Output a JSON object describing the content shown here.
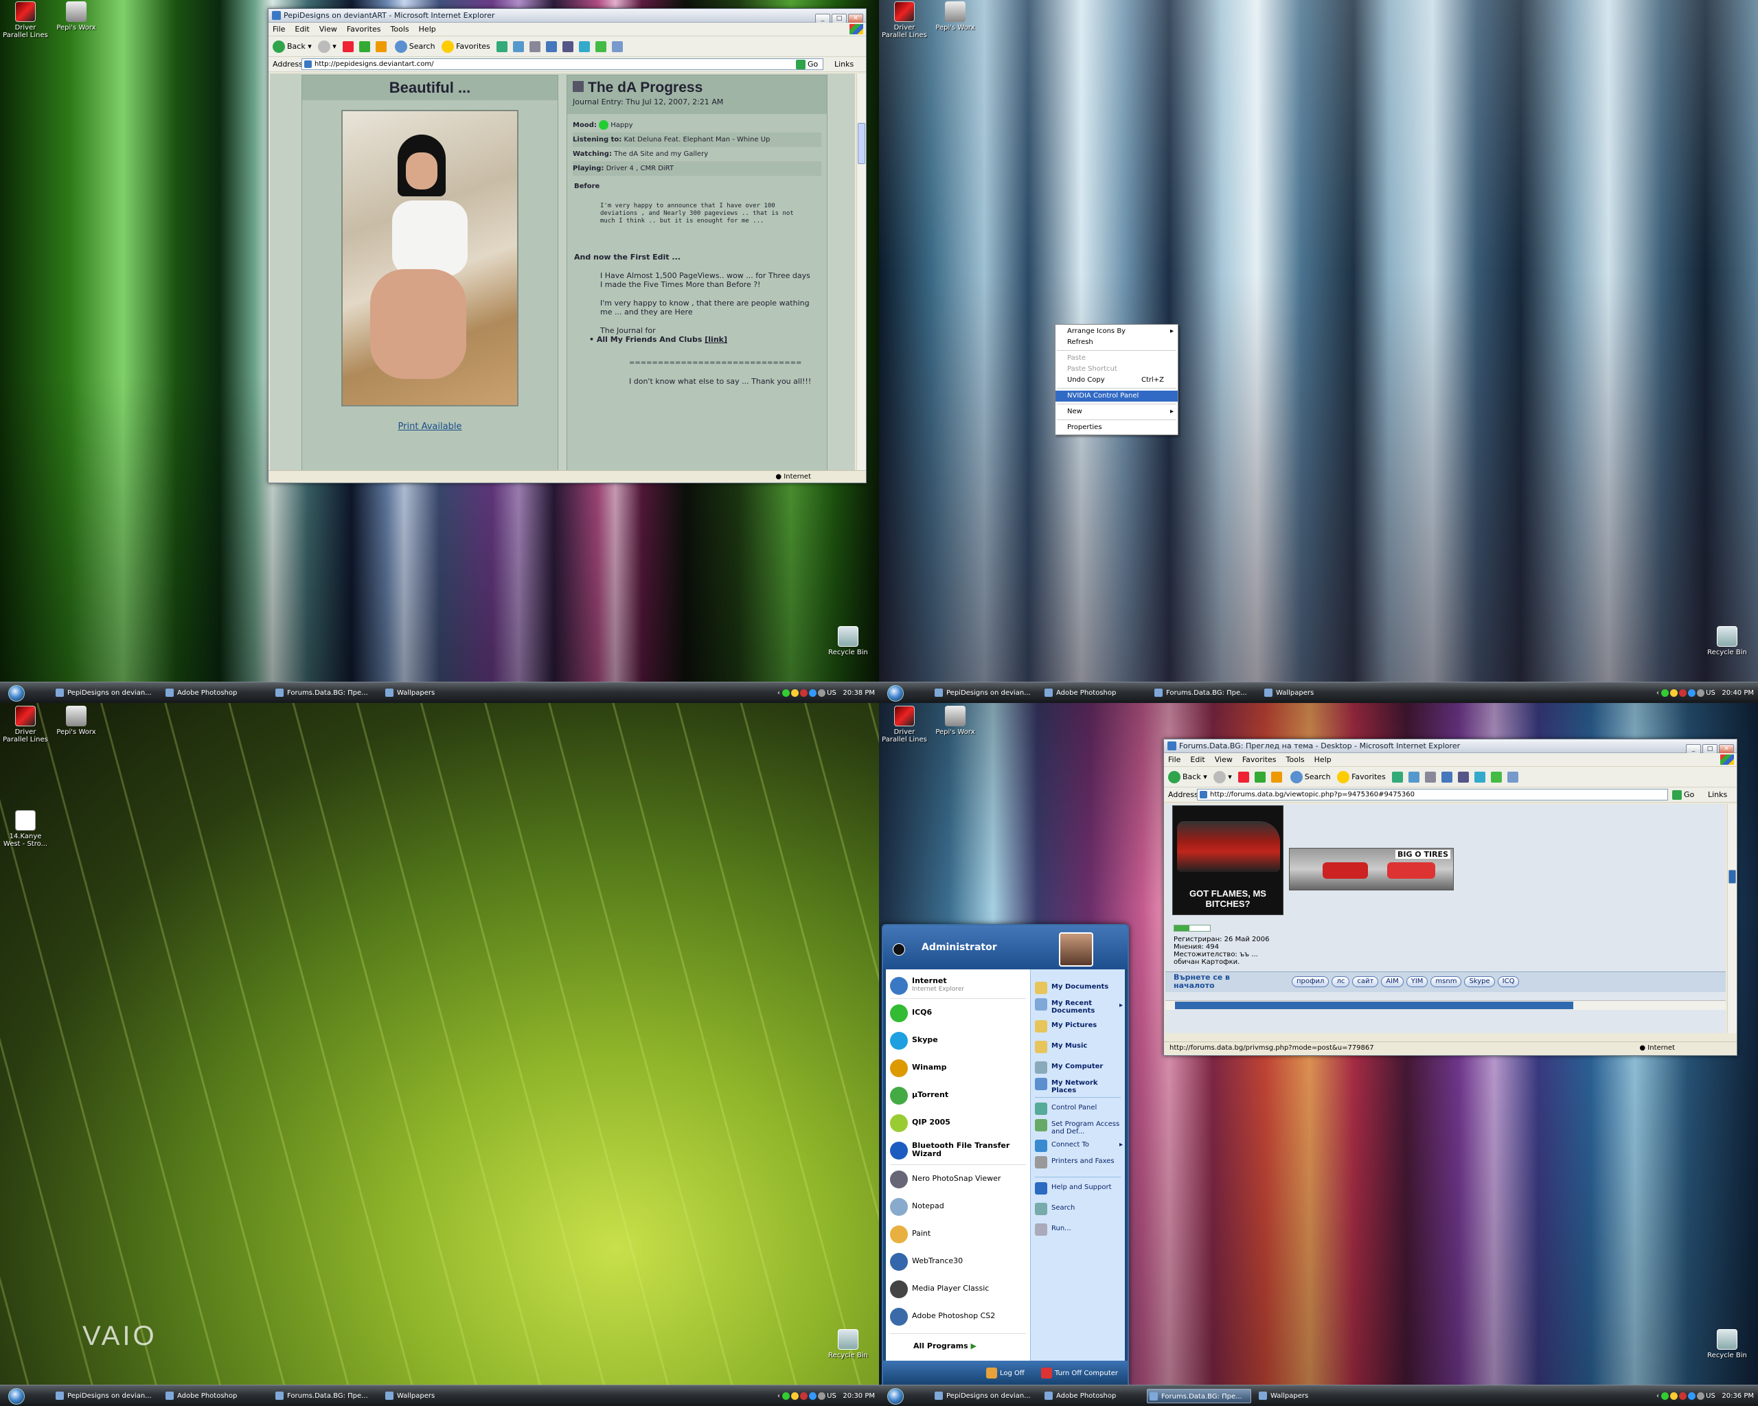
{
  "desktop_icons": {
    "driver": "Driver Parallel Lines",
    "pepi": "Pepi's Worx",
    "bin": "Recycle Bin",
    "kanye": "14.Kanye West - Stro..."
  },
  "taskbar": {
    "items": [
      "PepiDesigns on devian...",
      "Adobe Photoshop",
      "Forums.Data.BG: Пре...",
      "Wallpapers"
    ],
    "lang": "US",
    "time_q1": "20:38 PM",
    "time_q2": "20:40 PM",
    "time_q3": "20:30 PM",
    "time_q4": "20:36 PM"
  },
  "ie_common": {
    "menu": [
      "File",
      "Edit",
      "View",
      "Favorites",
      "Tools",
      "Help"
    ],
    "back": "Back",
    "search": "Search",
    "favorites": "Favorites",
    "address_label": "Address",
    "go": "Go",
    "links": "Links",
    "zone": "Internet"
  },
  "da_window": {
    "title": "PepiDesigns on deviantART - Microsoft Internet Explorer",
    "url": "http://pepidesigns.deviantart.com/",
    "deviation_title": "Beautiful ...",
    "print_link": "Print Available",
    "journal_title": "The dA Progress",
    "journal_date": "Journal Entry: Thu Jul 12, 2007, 2:21 AM",
    "mood_label": "Mood:",
    "mood": "Happy",
    "listening_label": "Listening to:",
    "listening": "Kat Deluna Feat. Elephant Man - Whine Up",
    "watching_label": "Watching:",
    "watching": "The dA Site and my Gallery",
    "playing_label": "Playing:",
    "playing": "Driver 4 , CMR DiRT",
    "before": "Before",
    "p1": "I'm very happy to announce that I have over 100 deviations , and Nearly 300 pageviews .. that is not much I think .. but it is enought for me ...",
    "first_edit": "And now the First Edit ...",
    "p2": "I Have Almost 1,500 PageViews.. wow ... for Three days I made the Five Times More than Before ?!",
    "p3": "I'm very happy to know , that there are people wathing me ... and they are Here",
    "journal_for": "The Journal for",
    "bullet": "All My Friends And Clubs",
    "link": "[link]",
    "divider": "==============================",
    "p4": "I don't know what else to say ... Thank you all!!!"
  },
  "context_menu": {
    "arrange": "Arrange Icons By",
    "refresh": "Refresh",
    "paste": "Paste",
    "paste_shortcut": "Paste Shortcut",
    "undo": "Undo Copy",
    "undo_sc": "Ctrl+Z",
    "nvidia": "NVIDIA Control Panel",
    "new": "New",
    "properties": "Properties"
  },
  "vaio_logo": "VAIO",
  "forum_window": {
    "title": "Forums.Data.BG: Преглед на тема - Desktop - Microsoft Internet Explorer",
    "url": "http://forums.data.bg/viewtopic.php?p=9475360#9475360",
    "sig_caption": "GOT FLAMES, MS BITCHES?",
    "sig_banner": "BIG O TIRES",
    "registered": "Регистриран: 26 Май 2006",
    "posts": "Мнения: 494",
    "location": "Местожителство: ъъ ...",
    "rank": "обичан Картофки.",
    "back_top": "Върнете се в началото",
    "buttons": [
      "профил",
      "лс",
      "сайт",
      "AIM",
      "YIM",
      "msnm",
      "Skype",
      "ICQ"
    ],
    "status_url": "http://forums.data.bg/privmsg.php?mode=post&u=779867"
  },
  "start_menu": {
    "user": "Administrator",
    "pinned": [
      {
        "name": "Internet",
        "sub": "Internet Explorer"
      }
    ],
    "programs": [
      "ICQ6",
      "Skype",
      "Winamp",
      "µTorrent",
      "QIP 2005",
      "Bluetooth File Transfer Wizard",
      "Nero PhotoSnap Viewer",
      "Notepad",
      "Paint",
      "WebTrance30",
      "Media Player Classic",
      "Adobe Photoshop CS2"
    ],
    "all_programs": "All Programs",
    "right": [
      "My Documents",
      "My Recent Documents",
      "My Pictures",
      "My Music",
      "My Computer",
      "My Network Places",
      "Control Panel",
      "Set Program Access and Def...",
      "Connect To",
      "Printers and Faxes",
      "Help and Support",
      "Search",
      "Run..."
    ],
    "logoff": "Log Off",
    "turnoff": "Turn Off Computer"
  }
}
